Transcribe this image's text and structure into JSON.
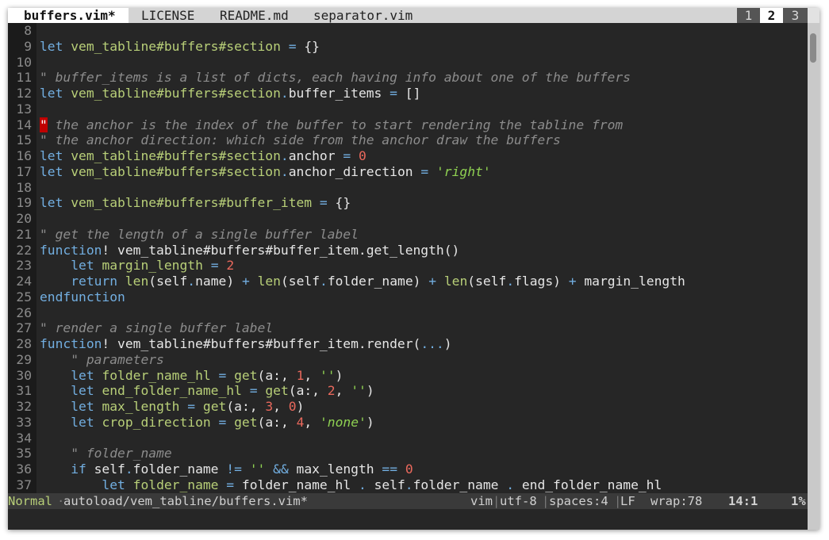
{
  "tabline": {
    "tabs": [
      {
        "label": "buffers.vim*",
        "active": true
      },
      {
        "label": "LICENSE",
        "active": false
      },
      {
        "label": "README.md",
        "active": false
      },
      {
        "label": "separator.vim",
        "active": false
      }
    ],
    "tabpages": [
      {
        "label": "1",
        "active": false
      },
      {
        "label": "2",
        "active": true
      },
      {
        "label": "3",
        "active": false
      }
    ]
  },
  "editor": {
    "lines": [
      {
        "num": "8",
        "tokens": []
      },
      {
        "num": "9",
        "tokens": [
          [
            "k",
            "let"
          ],
          [
            "t",
            " "
          ],
          [
            "i",
            "vem_tabline#buffers#section"
          ],
          [
            "t",
            " "
          ],
          [
            "o",
            "="
          ],
          [
            "t",
            " {}"
          ]
        ]
      },
      {
        "num": "10",
        "tokens": []
      },
      {
        "num": "11",
        "tokens": [
          [
            "c",
            "\" buffer_items is a list of dicts, each having info about one of the buffers"
          ]
        ]
      },
      {
        "num": "12",
        "tokens": [
          [
            "k",
            "let"
          ],
          [
            "t",
            " "
          ],
          [
            "i",
            "vem_tabline#buffers#section"
          ],
          [
            "o",
            "."
          ],
          [
            "t",
            "buffer_items "
          ],
          [
            "o",
            "="
          ],
          [
            "t",
            " []"
          ]
        ]
      },
      {
        "num": "13",
        "tokens": []
      },
      {
        "num": "14",
        "tokens": [
          [
            "cur",
            "\""
          ],
          [
            "c",
            " the anchor is the index of the buffer to start rendering the tabline from"
          ]
        ]
      },
      {
        "num": "15",
        "tokens": [
          [
            "c",
            "\" the anchor direction: which side from the anchor draw the buffers"
          ]
        ]
      },
      {
        "num": "16",
        "tokens": [
          [
            "k",
            "let"
          ],
          [
            "t",
            " "
          ],
          [
            "i",
            "vem_tabline#buffers#section"
          ],
          [
            "o",
            "."
          ],
          [
            "t",
            "anchor "
          ],
          [
            "o",
            "="
          ],
          [
            "t",
            " "
          ],
          [
            "n",
            "0"
          ]
        ]
      },
      {
        "num": "17",
        "tokens": [
          [
            "k",
            "let"
          ],
          [
            "t",
            " "
          ],
          [
            "i",
            "vem_tabline#buffers#section"
          ],
          [
            "o",
            "."
          ],
          [
            "t",
            "anchor_direction "
          ],
          [
            "o",
            "="
          ],
          [
            "t",
            " "
          ],
          [
            "q",
            "'"
          ],
          [
            "s",
            "right"
          ],
          [
            "q",
            "'"
          ]
        ]
      },
      {
        "num": "18",
        "tokens": []
      },
      {
        "num": "19",
        "tokens": [
          [
            "k",
            "let"
          ],
          [
            "t",
            " "
          ],
          [
            "i",
            "vem_tabline#buffers#buffer_item"
          ],
          [
            "t",
            " "
          ],
          [
            "o",
            "="
          ],
          [
            "t",
            " {}"
          ]
        ]
      },
      {
        "num": "20",
        "tokens": []
      },
      {
        "num": "21",
        "tokens": [
          [
            "c",
            "\" get the length of a single buffer label"
          ]
        ]
      },
      {
        "num": "22",
        "tokens": [
          [
            "k",
            "function"
          ],
          [
            "t",
            "! vem_tabline#buffers#buffer_item.get_length()"
          ]
        ]
      },
      {
        "num": "23",
        "tokens": [
          [
            "t",
            "    "
          ],
          [
            "k",
            "let"
          ],
          [
            "t",
            " "
          ],
          [
            "i",
            "margin_length"
          ],
          [
            "t",
            " "
          ],
          [
            "o",
            "="
          ],
          [
            "t",
            " "
          ],
          [
            "n",
            "2"
          ]
        ]
      },
      {
        "num": "24",
        "tokens": [
          [
            "t",
            "    "
          ],
          [
            "k",
            "return"
          ],
          [
            "t",
            " "
          ],
          [
            "i",
            "len"
          ],
          [
            "t",
            "(self"
          ],
          [
            "o",
            "."
          ],
          [
            "t",
            "name) "
          ],
          [
            "o",
            "+"
          ],
          [
            "t",
            " "
          ],
          [
            "i",
            "len"
          ],
          [
            "t",
            "(self"
          ],
          [
            "o",
            "."
          ],
          [
            "t",
            "folder_name) "
          ],
          [
            "o",
            "+"
          ],
          [
            "t",
            " "
          ],
          [
            "i",
            "len"
          ],
          [
            "t",
            "(self"
          ],
          [
            "o",
            "."
          ],
          [
            "t",
            "flags) "
          ],
          [
            "o",
            "+"
          ],
          [
            "t",
            " margin_length"
          ]
        ]
      },
      {
        "num": "25",
        "tokens": [
          [
            "k",
            "endfunction"
          ]
        ]
      },
      {
        "num": "26",
        "tokens": []
      },
      {
        "num": "27",
        "tokens": [
          [
            "c",
            "\" render a single buffer label"
          ]
        ]
      },
      {
        "num": "28",
        "tokens": [
          [
            "k",
            "function"
          ],
          [
            "t",
            "! vem_tabline#buffers#buffer_item.render("
          ],
          [
            "o",
            "..."
          ],
          [
            "t",
            ")"
          ]
        ]
      },
      {
        "num": "29",
        "tokens": [
          [
            "t",
            "    "
          ],
          [
            "c",
            "\" parameters"
          ]
        ]
      },
      {
        "num": "30",
        "tokens": [
          [
            "t",
            "    "
          ],
          [
            "k",
            "let"
          ],
          [
            "t",
            " "
          ],
          [
            "i",
            "folder_name_hl"
          ],
          [
            "t",
            " "
          ],
          [
            "o",
            "="
          ],
          [
            "t",
            " "
          ],
          [
            "i",
            "get"
          ],
          [
            "t",
            "(a:, "
          ],
          [
            "n",
            "1"
          ],
          [
            "t",
            ", "
          ],
          [
            "q",
            "''"
          ],
          [
            "t",
            ")"
          ]
        ]
      },
      {
        "num": "31",
        "tokens": [
          [
            "t",
            "    "
          ],
          [
            "k",
            "let"
          ],
          [
            "t",
            " "
          ],
          [
            "i",
            "end_folder_name_hl"
          ],
          [
            "t",
            " "
          ],
          [
            "o",
            "="
          ],
          [
            "t",
            " "
          ],
          [
            "i",
            "get"
          ],
          [
            "t",
            "(a:, "
          ],
          [
            "n",
            "2"
          ],
          [
            "t",
            ", "
          ],
          [
            "q",
            "''"
          ],
          [
            "t",
            ")"
          ]
        ]
      },
      {
        "num": "32",
        "tokens": [
          [
            "t",
            "    "
          ],
          [
            "k",
            "let"
          ],
          [
            "t",
            " "
          ],
          [
            "i",
            "max_length"
          ],
          [
            "t",
            " "
          ],
          [
            "o",
            "="
          ],
          [
            "t",
            " "
          ],
          [
            "i",
            "get"
          ],
          [
            "t",
            "(a:, "
          ],
          [
            "n",
            "3"
          ],
          [
            "t",
            ", "
          ],
          [
            "n",
            "0"
          ],
          [
            "t",
            ")"
          ]
        ]
      },
      {
        "num": "33",
        "tokens": [
          [
            "t",
            "    "
          ],
          [
            "k",
            "let"
          ],
          [
            "t",
            " "
          ],
          [
            "i",
            "crop_direction"
          ],
          [
            "t",
            " "
          ],
          [
            "o",
            "="
          ],
          [
            "t",
            " "
          ],
          [
            "i",
            "get"
          ],
          [
            "t",
            "(a:, "
          ],
          [
            "n",
            "4"
          ],
          [
            "t",
            ", "
          ],
          [
            "q",
            "'"
          ],
          [
            "s",
            "none"
          ],
          [
            "q",
            "'"
          ],
          [
            "t",
            ")"
          ]
        ]
      },
      {
        "num": "34",
        "tokens": []
      },
      {
        "num": "35",
        "tokens": [
          [
            "t",
            "    "
          ],
          [
            "c",
            "\" folder_name"
          ]
        ]
      },
      {
        "num": "36",
        "tokens": [
          [
            "t",
            "    "
          ],
          [
            "k",
            "if"
          ],
          [
            "t",
            " self"
          ],
          [
            "o",
            "."
          ],
          [
            "t",
            "folder_name "
          ],
          [
            "o",
            "!="
          ],
          [
            "t",
            " "
          ],
          [
            "q",
            "''"
          ],
          [
            "t",
            " "
          ],
          [
            "o",
            "&&"
          ],
          [
            "t",
            " max_length "
          ],
          [
            "o",
            "=="
          ],
          [
            "t",
            " "
          ],
          [
            "n",
            "0"
          ]
        ]
      },
      {
        "num": "37",
        "tokens": [
          [
            "t",
            "        "
          ],
          [
            "k",
            "let"
          ],
          [
            "t",
            " "
          ],
          [
            "i",
            "folder_name"
          ],
          [
            "t",
            " "
          ],
          [
            "o",
            "="
          ],
          [
            "t",
            " folder_name_hl "
          ],
          [
            "o",
            "."
          ],
          [
            "t",
            " self"
          ],
          [
            "o",
            "."
          ],
          [
            "t",
            "folder_name "
          ],
          [
            "o",
            "."
          ],
          [
            "t",
            " end_folder_name_hl"
          ]
        ]
      }
    ]
  },
  "statusline": {
    "mode": "Normal",
    "separator": "·",
    "file": "autoload/vem_tabline/buffers.vim*",
    "filetype": "vim",
    "encoding": "utf-8",
    "indent": "spaces:4",
    "format": "LF",
    "pipe": "|",
    "wrap": "wrap:78",
    "position": "14:1",
    "percent": "1%"
  },
  "colors": {
    "keyword": "#72aee0",
    "identifier": "#b8cf78",
    "number": "#e8685c",
    "string": "#8fd152",
    "comment": "#8c8c8c",
    "cursor": "#c00000",
    "background": "#262626"
  }
}
